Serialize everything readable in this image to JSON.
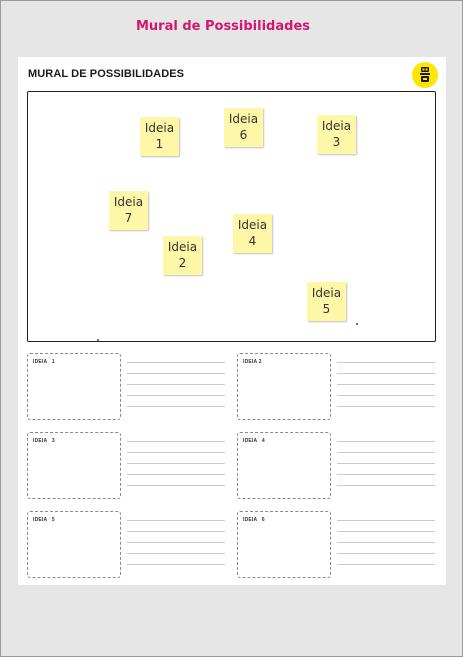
{
  "page_title": "Mural de Possibilidades",
  "sheet": {
    "title": "MURAL DE POSSIBILIDADES",
    "logo_icon": "yellow-circle-mascot-icon"
  },
  "board": {
    "notes": [
      {
        "word": "Ideia",
        "num": "1"
      },
      {
        "word": "Ideia",
        "num": "6"
      },
      {
        "word": "Ideia",
        "num": "3"
      },
      {
        "word": "Ideia",
        "num": "7"
      },
      {
        "word": "Ideia",
        "num": "4"
      },
      {
        "word": "Ideia",
        "num": "2"
      },
      {
        "word": "Ideia",
        "num": "5"
      }
    ]
  },
  "idea_boxes": [
    {
      "label": "IDEIA   1"
    },
    {
      "label": "IDEIA 2"
    },
    {
      "label": "IDEIA   3"
    },
    {
      "label": "IDEIA   4"
    },
    {
      "label": "IDEIA   5"
    },
    {
      "label": "IDEIA   6"
    }
  ],
  "colors": {
    "title_magenta": "#d3176f",
    "sticky_yellow": "#fff7a8",
    "logo_yellow": "#ffe500"
  }
}
